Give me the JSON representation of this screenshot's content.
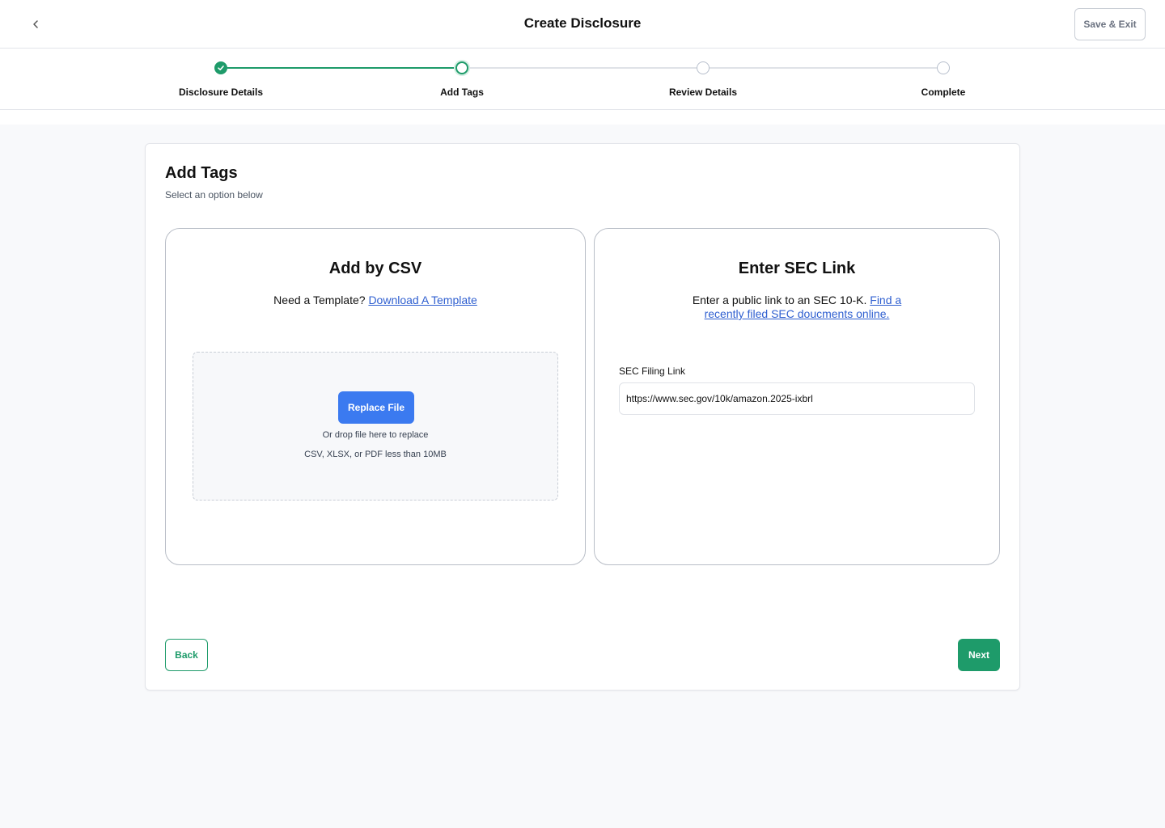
{
  "header": {
    "title": "Create Disclosure",
    "back_icon": "chevron-left-icon",
    "save_exit_label": "Save & Exit"
  },
  "stepper": {
    "steps": [
      {
        "label": "Disclosure Details",
        "status": "complete"
      },
      {
        "label": "Add Tags",
        "status": "current"
      },
      {
        "label": "Review Details",
        "status": "upcoming"
      },
      {
        "label": "Complete",
        "status": "upcoming"
      }
    ]
  },
  "card": {
    "title": "Add Tags",
    "subtitle": "Select an option below"
  },
  "csv_option": {
    "title": "Add by CSV",
    "prompt": "Need a Template?",
    "link_label": "Download A Template",
    "replace_button": "Replace File",
    "drop_hint": "Or drop file here to replace",
    "file_types": "CSV, XLSX, or PDF less than 10MB"
  },
  "sec_option": {
    "title": "Enter SEC Link",
    "prompt": "Enter a public link to an SEC 10-K.",
    "link_label": "Find a recently filed SEC doucments online.",
    "field_label": "SEC Filing Link",
    "field_value": "https://www.sec.gov/10k/amazon.2025-ixbrl"
  },
  "footer": {
    "back_label": "Back",
    "next_label": "Next"
  },
  "colors": {
    "accent_green": "#1e9b6a",
    "primary_blue": "#3b7af0",
    "link_blue": "#2f5fd0"
  }
}
